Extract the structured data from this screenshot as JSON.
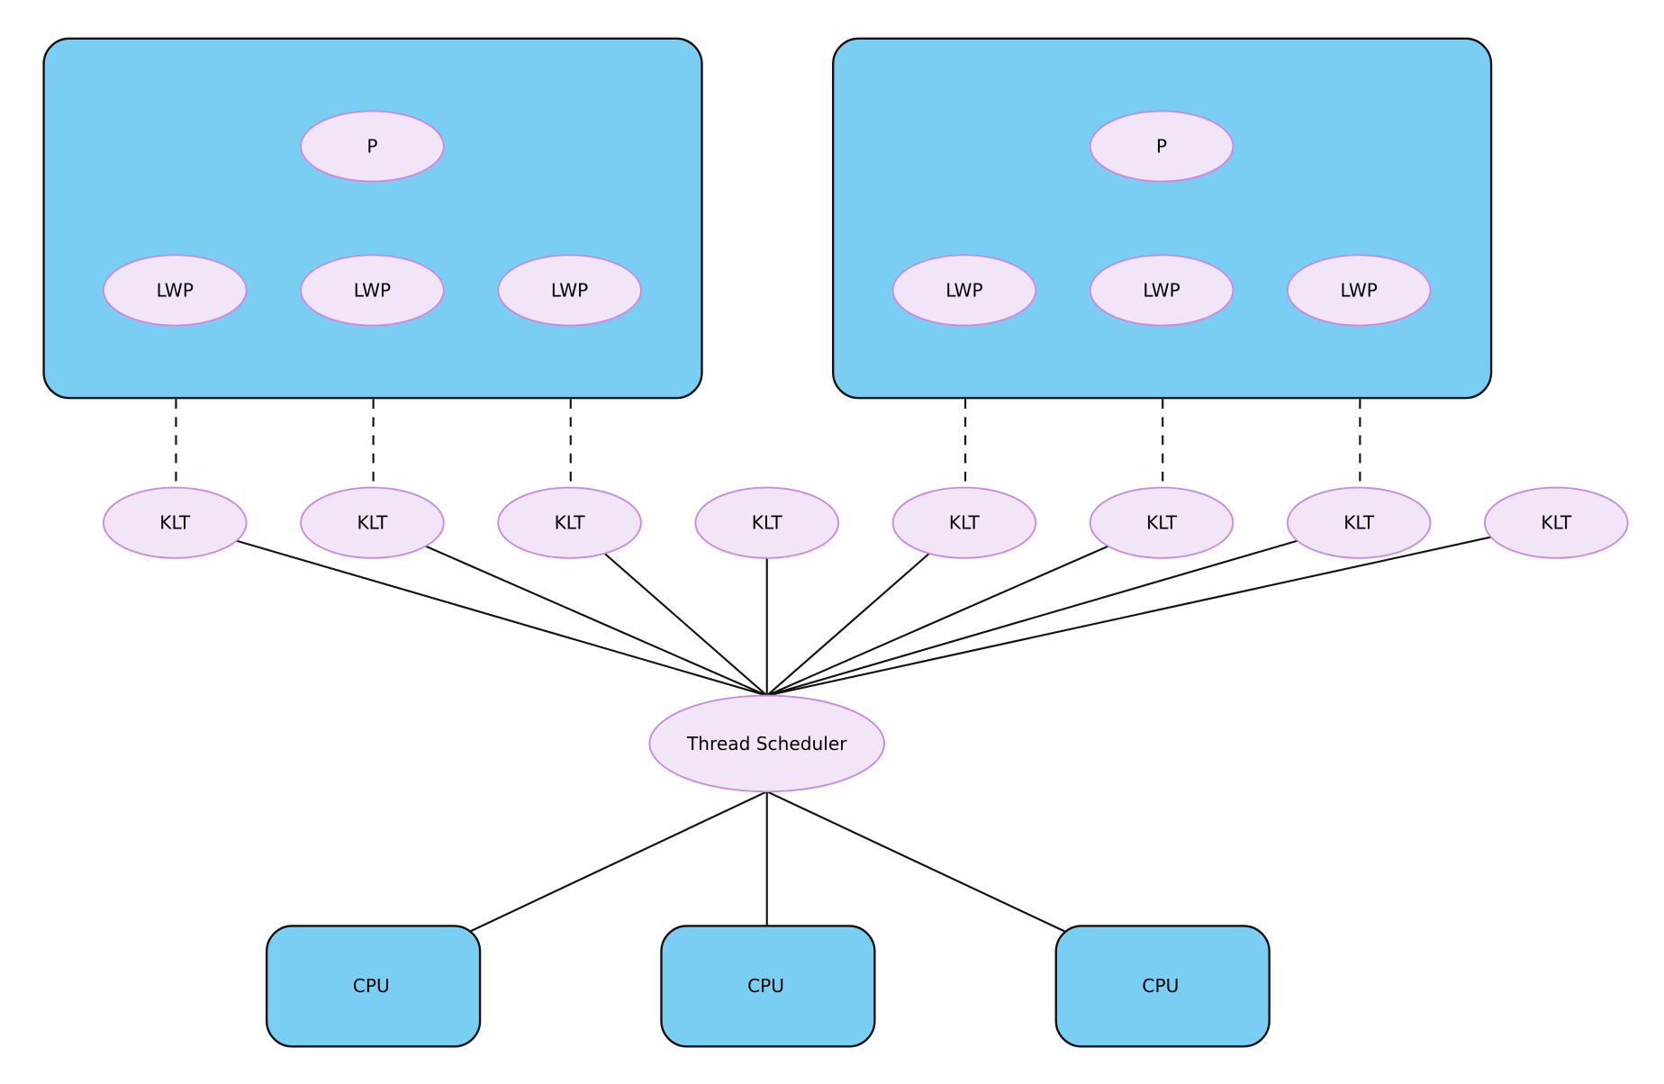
{
  "colors": {
    "container_fill": "#7acef3",
    "node_fill": "#f2e5f7",
    "node_stroke": "#c98be2",
    "edge": "#111111"
  },
  "processes": [
    {
      "label": "P",
      "lwps": [
        "LWP",
        "LWP",
        "LWP"
      ]
    },
    {
      "label": "P",
      "lwps": [
        "LWP",
        "LWP",
        "LWP"
      ]
    }
  ],
  "klts": [
    "KLT",
    "KLT",
    "KLT",
    "KLT",
    "KLT",
    "KLT",
    "KLT",
    "KLT"
  ],
  "scheduler": {
    "label": "Thread Scheduler"
  },
  "cpus": [
    "CPU",
    "CPU",
    "CPU"
  ],
  "edges": {
    "p_to_lwp": "solid",
    "lwp_to_klt": "dashed",
    "klt_to_scheduler": "solid",
    "scheduler_to_cpu": "solid"
  }
}
